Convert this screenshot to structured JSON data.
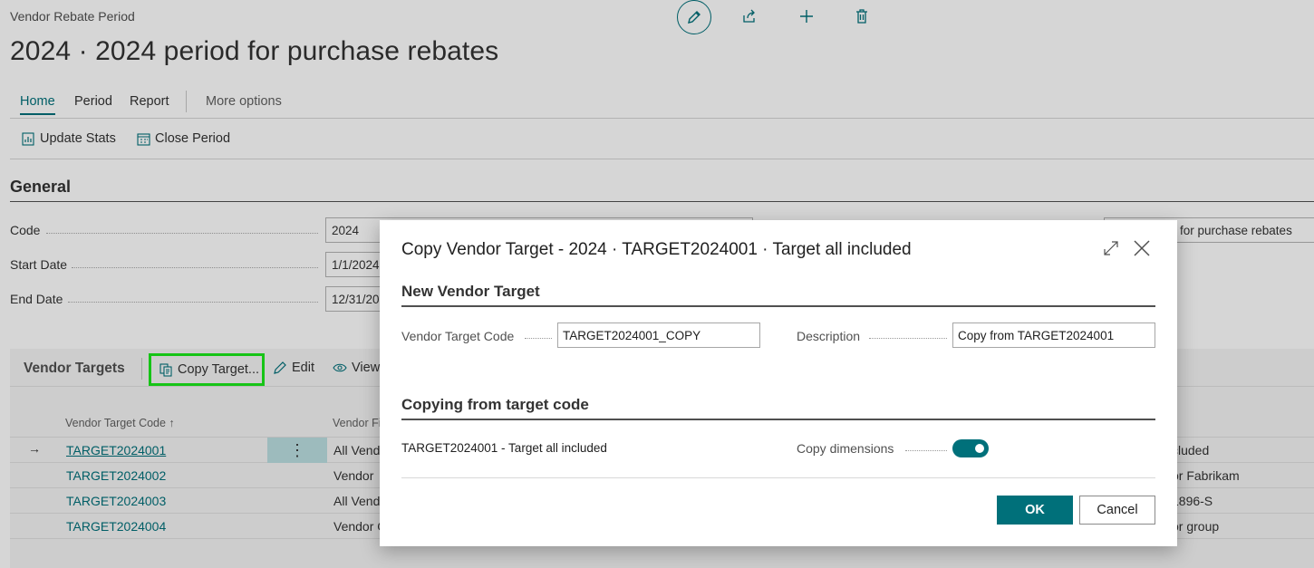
{
  "page": {
    "breadcrumb": "Vendor Rebate Period",
    "title": "2024 · 2024 period for purchase rebates",
    "top_actions": [
      "edit-icon",
      "share-icon",
      "add-icon",
      "delete-icon"
    ]
  },
  "tabs": {
    "home": "Home",
    "period": "Period",
    "report": "Report",
    "more": "More options"
  },
  "actions": {
    "update_stats": "Update Stats",
    "close_period": "Close Period"
  },
  "general": {
    "heading": "General",
    "fields": [
      {
        "label": "Code",
        "value": "2024"
      },
      {
        "label": "Start Date",
        "value": "1/1/2024"
      },
      {
        "label": "End Date",
        "value": "12/31/20"
      }
    ],
    "description_partial": "for purchase rebates"
  },
  "vendor_targets": {
    "title": "Vendor Targets",
    "copy_target": "Copy Target...",
    "edit": "Edit",
    "view": "View",
    "columns": {
      "code": "Vendor Target Code ↑",
      "filter": "Vendor Fi"
    },
    "rows": [
      {
        "code": "TARGET2024001",
        "filter": "All Vend",
        "desc": "cluded",
        "selected": true
      },
      {
        "code": "TARGET2024002",
        "filter": "Vendor",
        "desc": "or Fabrikam",
        "selected": false
      },
      {
        "code": "TARGET2024003",
        "filter": "All Vend",
        "desc": "1896-S",
        "selected": false
      },
      {
        "code": "TARGET2024004",
        "filter": "Vendor G",
        "desc": "or group",
        "selected": false
      }
    ]
  },
  "dialog": {
    "title": "Copy Vendor Target - 2024 · TARGET2024001 · Target all included",
    "section_new": "New Vendor Target",
    "vendor_target_code_label": "Vendor Target Code",
    "vendor_target_code_value": "TARGET2024001_COPY",
    "description_label": "Description",
    "description_value": "Copy from TARGET2024001",
    "section_copying": "Copying from target code",
    "copying_from_text": "TARGET2024001 - Target all included",
    "copy_dimensions_label": "Copy dimensions",
    "copy_dimensions_on": true,
    "ok": "OK",
    "cancel": "Cancel"
  },
  "colors": {
    "accent": "#00707a",
    "highlight": "#1bea1b"
  }
}
